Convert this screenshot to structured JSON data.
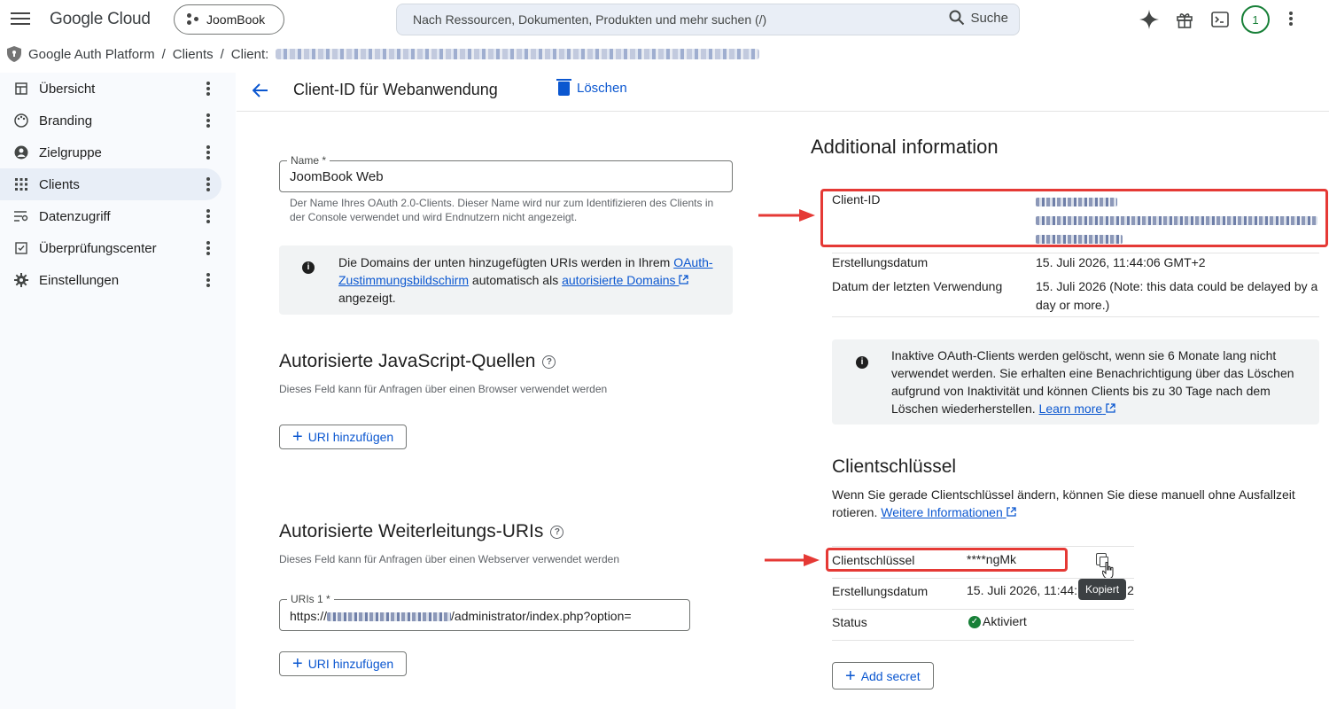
{
  "header": {
    "logo": "Google Cloud",
    "project": "JoomBook",
    "search_placeholder": "Nach Ressourcen, Dokumenten, Produkten und mehr suchen (/)",
    "search_button": "Suche",
    "avatar_badge": "1"
  },
  "breadcrumb": {
    "items": [
      "Google Auth Platform",
      "Clients",
      "Client:"
    ],
    "separator": "/"
  },
  "sidebar": {
    "items": [
      {
        "label": "Übersicht",
        "icon": "dashboard-icon"
      },
      {
        "label": "Branding",
        "icon": "palette-icon"
      },
      {
        "label": "Zielgruppe",
        "icon": "person-icon"
      },
      {
        "label": "Clients",
        "icon": "grid-icon",
        "active": true
      },
      {
        "label": "Datenzugriff",
        "icon": "filter-list-icon"
      },
      {
        "label": "Überprüfungscenter",
        "icon": "checkbox-icon"
      },
      {
        "label": "Einstellungen",
        "icon": "gear-icon"
      }
    ]
  },
  "titlebar": {
    "title": "Client-ID für Webanwendung",
    "delete_label": "Löschen"
  },
  "form": {
    "name_label": "Name *",
    "name_value": "JoomBook Web",
    "name_hint": "Der Name Ihres OAuth 2.0-Clients. Dieser Name wird nur zum Identifizieren des Clients in der Console verwendet und wird Endnutzern nicht angezeigt.",
    "domains_info_pre": "Die Domains der unten hinzugefügten URIs werden in Ihrem ",
    "domains_info_link1": "OAuth-Zustimmungsbildschirm",
    "domains_info_mid": " automatisch als ",
    "domains_info_link2": "autorisierte Domains",
    "domains_info_post": " angezeigt.",
    "js_origins_title": "Autorisierte JavaScript-Quellen",
    "js_origins_hint": "Dieses Feld kann für Anfragen über einen Browser verwendet werden",
    "add_uri_label": "URI hinzufügen",
    "redirect_title": "Autorisierte Weiterleitungs-URIs",
    "redirect_hint": "Dieses Feld kann für Anfragen über einen Webserver verwendet werden",
    "uri1_label": "URIs 1 *",
    "uri1_prefix": "https://",
    "uri1_suffix": "/administrator/index.php?option="
  },
  "additional": {
    "title": "Additional information",
    "client_id_label": "Client-ID",
    "created_label": "Erstellungsdatum",
    "created_value": "15. Juli 2026, 11:44:06 GMT+2",
    "last_used_label": "Datum der letzten Verwendung",
    "last_used_value": "15. Juli 2026 (Note: this data could be delayed by a day or more.)",
    "inactive_info": "Inaktive OAuth-Clients werden gelöscht, wenn sie 6 Monate lang nicht verwendet werden. Sie erhalten eine Benachrichtigung über das Löschen aufgrund von Inaktivität und können Clients bis zu 30 Tage nach dem Löschen wiederherstellen. ",
    "learn_more": "Learn more"
  },
  "secrets": {
    "title": "Clientschlüssel",
    "desc": "Wenn Sie gerade Clientschlüssel ändern, können Sie diese manuell ohne Ausfallzeit rotieren. ",
    "more_info": "Weitere Informationen",
    "secret_label": "Clientschlüssel",
    "secret_value": "****ngMk",
    "created_label": "Erstellungsdatum",
    "created_value": "15. Juli 2026, 11:44:",
    "created_value_tail": "2",
    "status_label": "Status",
    "status_value": "Aktiviert",
    "tooltip": "Kopiert",
    "add_secret": "Add secret"
  },
  "colors": {
    "accent": "#0b57d0",
    "annotation": "#e53935",
    "success": "#188038"
  }
}
